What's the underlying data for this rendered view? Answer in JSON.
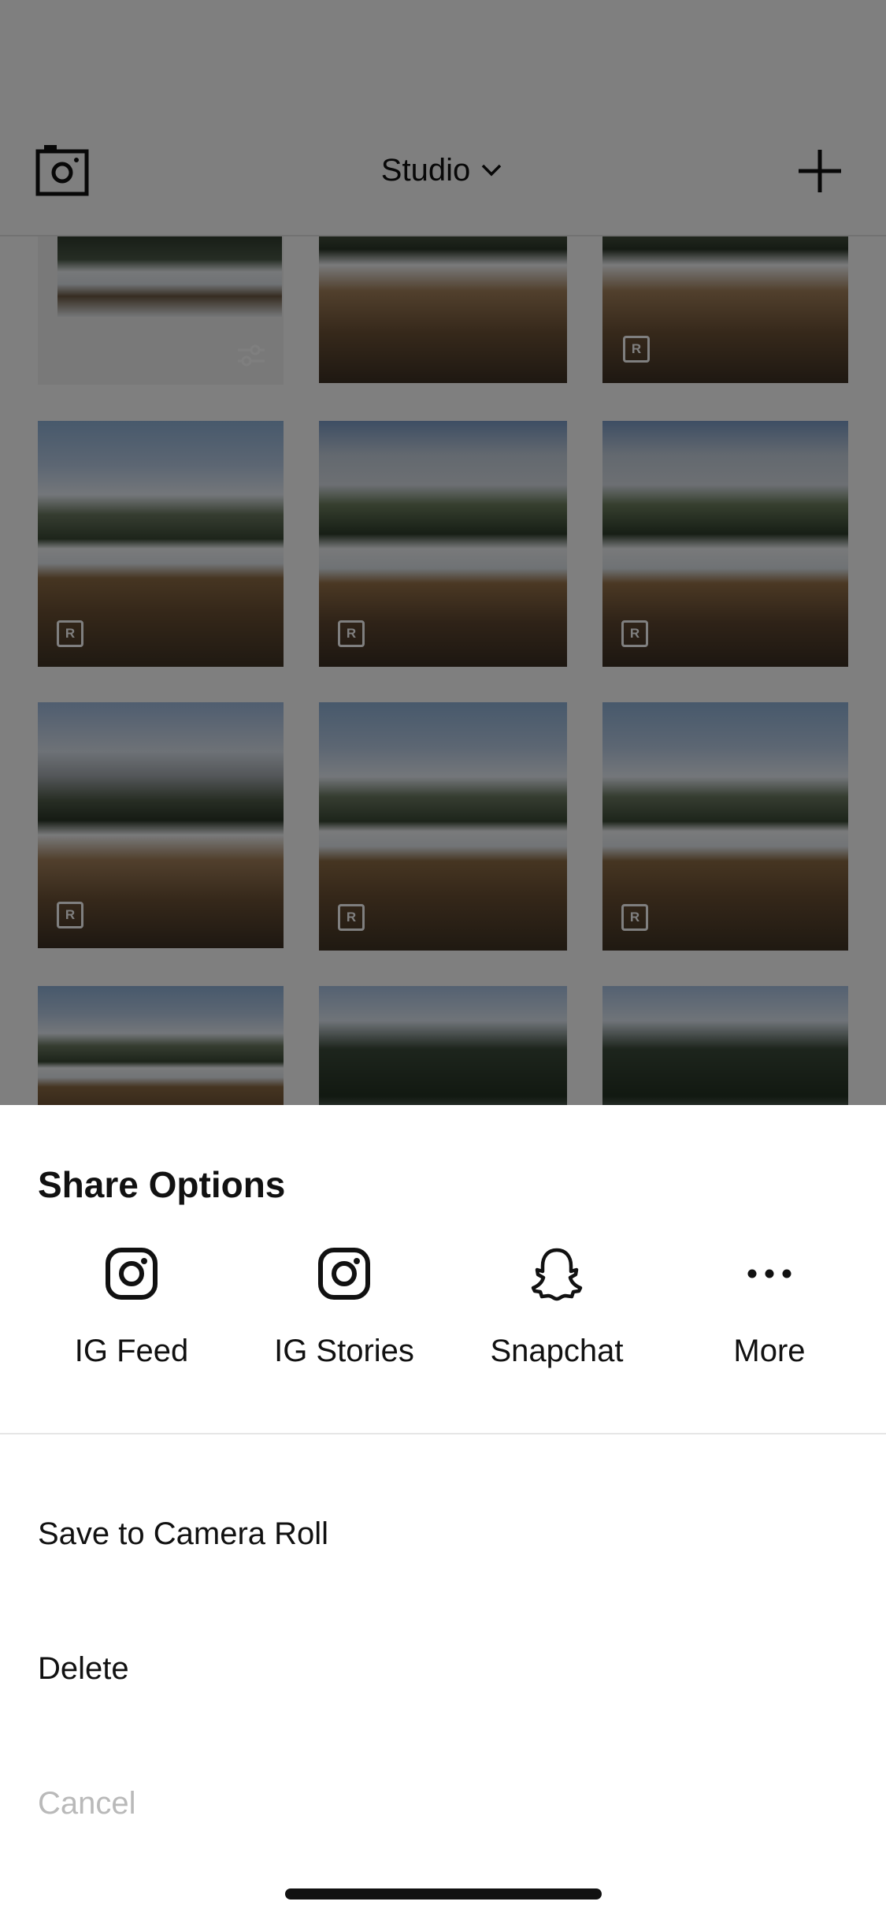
{
  "header": {
    "title": "Studio",
    "title_chevron_icon": "chevron-down-icon",
    "left_icon": "camera-icon",
    "right_icon": "plus-icon"
  },
  "grid": {
    "badge_label": "R"
  },
  "share_sheet": {
    "title": "Share Options",
    "options": [
      {
        "label": "IG Feed",
        "icon": "instagram-icon"
      },
      {
        "label": "IG Stories",
        "icon": "instagram-icon"
      },
      {
        "label": "Snapchat",
        "icon": "snapchat-ghost-icon"
      },
      {
        "label": "More",
        "icon": "more-dots-icon"
      }
    ],
    "actions": {
      "save": "Save to Camera Roll",
      "delete": "Delete",
      "cancel": "Cancel"
    }
  },
  "colors": {
    "sheet_background": "#ffffff",
    "overlay": "rgba(0,0,0,0.5)",
    "text_primary": "#111111",
    "text_disabled": "#b9b9b9"
  }
}
